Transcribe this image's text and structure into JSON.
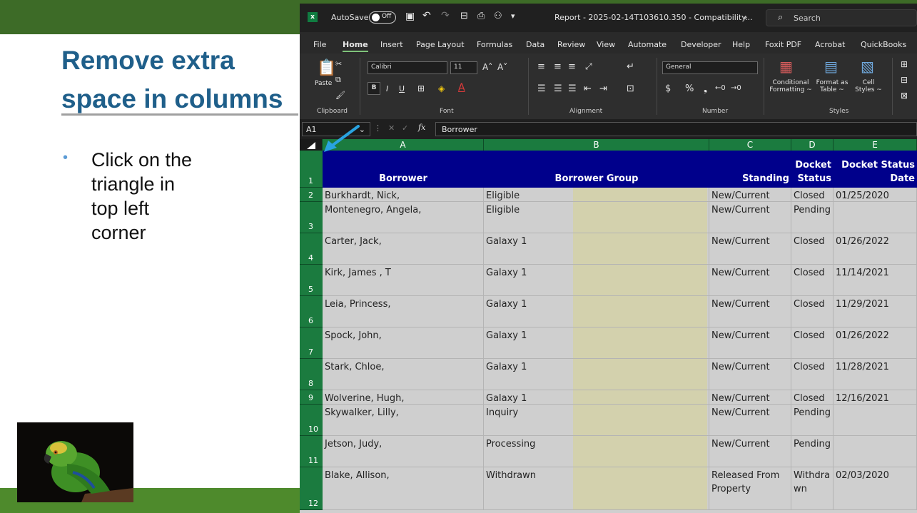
{
  "slide": {
    "title": "Remove extra space in columns",
    "bullet": "Click on the\ntriangle in\ntop left\ncorner"
  },
  "excel": {
    "autosave_label": "AutoSave",
    "autosave_state": "Off",
    "filename": "Report - 2025-02-14T103610.350  -  Compatibility...",
    "search_placeholder": "Search",
    "menu": [
      "File",
      "Home",
      "Insert",
      "Page Layout",
      "Formulas",
      "Data",
      "Review",
      "View",
      "Automate",
      "Developer",
      "Help",
      "Foxit PDF",
      "Acrobat",
      "QuickBooks"
    ],
    "active_tab": "Home",
    "ribbon": {
      "paste": "Paste",
      "font_name": "Calibri",
      "font_size": "11",
      "number_format": "General",
      "conditional_formatting": "Conditional\nFormatting ~",
      "format_as_table": "Format as\nTable ~",
      "cell_styles": "Cell\nStyles ~",
      "groups": [
        "Clipboard",
        "Font",
        "Alignment",
        "Number",
        "Styles"
      ]
    },
    "name_box": "A1",
    "formula": "Borrower",
    "columns": [
      "A",
      "B",
      "C",
      "D",
      "E"
    ],
    "headers": {
      "a": "Borrower",
      "b": "Borrower Group",
      "c": "Standing",
      "d": "Docket Status",
      "e": "Docket Status Date"
    },
    "rows": [
      {
        "num": "1"
      },
      {
        "num": "2",
        "a": "Burkhardt, Nick,",
        "b": "Eligible",
        "c": "New/Current",
        "d": "Closed",
        "e": "01/25/2020"
      },
      {
        "num": "3",
        "a": "Montenegro, Angela,",
        "b": "Eligible",
        "c": "New/Current",
        "d": "Pending",
        "e": ""
      },
      {
        "num": "4",
        "a": "Carter, Jack,",
        "b": "Galaxy 1",
        "c": "New/Current",
        "d": "Closed",
        "e": "01/26/2022"
      },
      {
        "num": "5",
        "a": "Kirk, James , T",
        "b": "Galaxy 1",
        "c": "New/Current",
        "d": "Closed",
        "e": "11/14/2021"
      },
      {
        "num": "6",
        "a": "Leia, Princess,",
        "b": "Galaxy 1",
        "c": "New/Current",
        "d": "Closed",
        "e": "11/29/2021"
      },
      {
        "num": "7",
        "a": "Spock, John,",
        "b": "Galaxy 1",
        "c": "New/Current",
        "d": "Closed",
        "e": "01/26/2022"
      },
      {
        "num": "8",
        "a": "Stark, Chloe,",
        "b": "Galaxy 1",
        "c": "New/Current",
        "d": "Closed",
        "e": "11/28/2021"
      },
      {
        "num": "9",
        "a": "Wolverine, Hugh,",
        "b": "Galaxy 1",
        "c": "New/Current",
        "d": "Closed",
        "e": "12/16/2021"
      },
      {
        "num": "10",
        "a": "Skywalker, Lilly,",
        "b": "Inquiry",
        "c": "New/Current",
        "d": "Pending",
        "e": ""
      },
      {
        "num": "11",
        "a": "Jetson, Judy,",
        "b": "Processing",
        "c": "New/Current",
        "d": "Pending",
        "e": ""
      },
      {
        "num": "12",
        "a": "Blake, Allison,",
        "b": "Withdrawn",
        "c": "Released From Property",
        "d": "Withdra wn",
        "e": "02/03/2020"
      }
    ]
  }
}
